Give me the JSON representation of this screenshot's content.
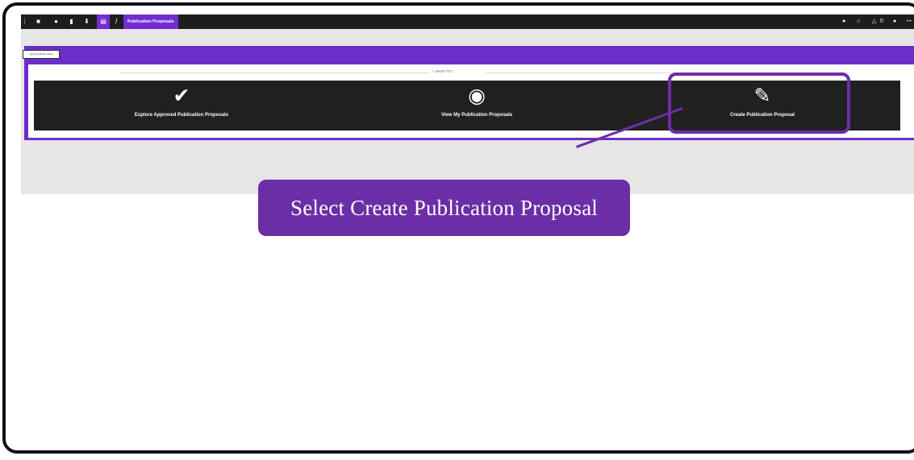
{
  "topbar": {
    "breadcrumb_separator": "/",
    "current_page": "Publication Proposals",
    "right_icons": [
      "help-icon",
      "bank-icon",
      "bell-icon",
      "user-icon",
      "logout-icon"
    ],
    "notification_count": "0"
  },
  "badge": {
    "text": "Vytvorit prazdny dotaz"
  },
  "main": {
    "prompt": "I WANT TO...",
    "options": [
      {
        "label": "Explore Approved Publication Proposals",
        "icon": "check-icon"
      },
      {
        "label": "View My Publication Proposals",
        "icon": "eye-icon"
      },
      {
        "label": "Create Publication Proposal",
        "icon": "edit-icon"
      }
    ]
  },
  "callout": {
    "text": "Select Create Publication Proposal"
  },
  "colors": {
    "accent": "#6c2ea6",
    "panel": "#6c2ec9",
    "option_bg": "#202020"
  }
}
